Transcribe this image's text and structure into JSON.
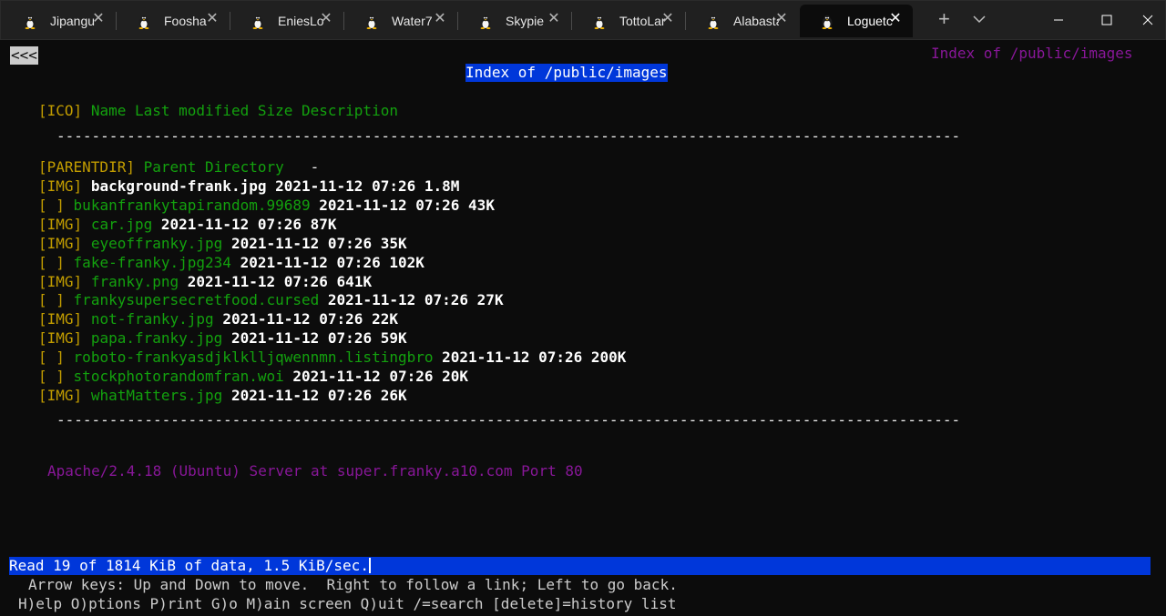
{
  "tabs": [
    {
      "label": "Jipangu",
      "active": false
    },
    {
      "label": "Foosha",
      "active": false
    },
    {
      "label": "EniesLol",
      "active": false
    },
    {
      "label": "Water7",
      "active": false
    },
    {
      "label": "Skypie",
      "active": false
    },
    {
      "label": "TottoLar",
      "active": false
    },
    {
      "label": "Alabasta",
      "active": false
    },
    {
      "label": "Loguetc",
      "active": true
    }
  ],
  "tab_close_glyph": "✕",
  "new_tab_glyph": "+",
  "page": {
    "back_link": "<<<",
    "corner_title": "Index of /public/images",
    "heading": "Index of /public/images",
    "columns": {
      "icon": "[ICO]",
      "header": "Name Last modified Size Description"
    },
    "separator": "-------------------------------------------------------------------------------------------------------",
    "parent": {
      "icon": "[PARENTDIR]",
      "name": "Parent Directory",
      "rest": "   -"
    },
    "files": [
      {
        "icon": "[IMG]",
        "name": "background-frank.jpg",
        "modified": "2021-11-12 07:26",
        "size": "1.8M",
        "selected": true
      },
      {
        "icon": "[ ]",
        "name": "bukanfrankytapirandom.99689",
        "modified": "2021-11-12 07:26",
        "size": "43K",
        "selected": false
      },
      {
        "icon": "[IMG]",
        "name": "car.jpg",
        "modified": "2021-11-12 07:26",
        "size": "87K",
        "selected": false
      },
      {
        "icon": "[IMG]",
        "name": "eyeoffranky.jpg",
        "modified": "2021-11-12 07:26",
        "size": "35K",
        "selected": false
      },
      {
        "icon": "[ ]",
        "name": "fake-franky.jpg234",
        "modified": "2021-11-12 07:26",
        "size": "102K",
        "selected": false
      },
      {
        "icon": "[IMG]",
        "name": "franky.png",
        "modified": "2021-11-12 07:26",
        "size": "641K",
        "selected": false
      },
      {
        "icon": "[ ]",
        "name": "frankysupersecretfood.cursed",
        "modified": "2021-11-12 07:26",
        "size": "27K",
        "selected": false
      },
      {
        "icon": "[IMG]",
        "name": "not-franky.jpg",
        "modified": "2021-11-12 07:26",
        "size": "22K",
        "selected": false
      },
      {
        "icon": "[IMG]",
        "name": "papa.franky.jpg",
        "modified": "2021-11-12 07:26",
        "size": "59K",
        "selected": false
      },
      {
        "icon": "[ ]",
        "name": "roboto-frankyasdjklklljqwennmn.listingbro",
        "modified": "2021-11-12 07:26",
        "size": "200K",
        "selected": false
      },
      {
        "icon": "[ ]",
        "name": "stockphotorandomfran.woi",
        "modified": "2021-11-12 07:26",
        "size": "20K",
        "selected": false
      },
      {
        "icon": "[IMG]",
        "name": "whatMatters.jpg",
        "modified": "2021-11-12 07:26",
        "size": "26K",
        "selected": false
      }
    ],
    "server_signature": "Apache/2.4.18 (Ubuntu) Server at super.franky.a10.com Port 80"
  },
  "status": {
    "message": "Read 19 of 1814 KiB of data, 1.5 KiB/sec.",
    "help_line1": "Arrow keys: Up and Down to move.  Right to follow a link; Left to go back.",
    "help_line2": "H)elp O)ptions P)rint G)o M)ain screen Q)uit /=search [delete]=history list"
  },
  "colors": {
    "background": "#0c0c0c",
    "link": "#13a10e",
    "icon_label": "#c19c00",
    "signature": "#881798",
    "highlight": "#0037da"
  }
}
